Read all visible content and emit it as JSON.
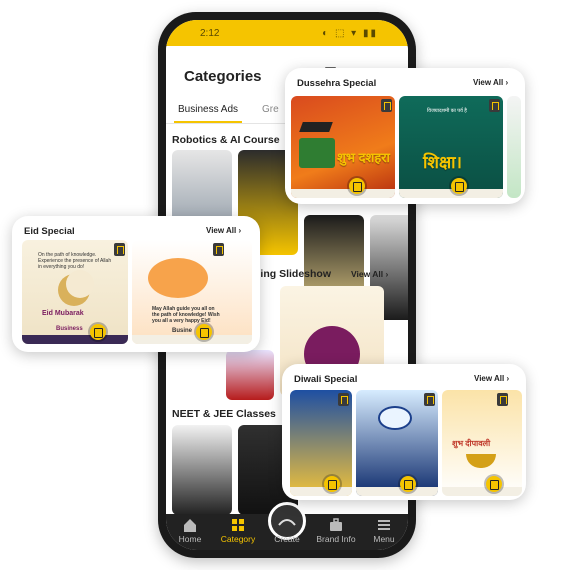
{
  "status": {
    "time": "2:12",
    "icons": "◐ ⬚ ▾ ▮▮"
  },
  "app": {
    "title": "Categories",
    "tabs": [
      {
        "label": "Business Ads"
      },
      {
        "label": "Gre"
      }
    ]
  },
  "sections": [
    {
      "title": "Robotics &  AI Course"
    },
    {
      "title": "hing Slideshow",
      "view_all": "View All"
    },
    {
      "title": "NEET & JEE Classes"
    }
  ],
  "bottom_nav": [
    {
      "label": "Home",
      "icon": "home-icon"
    },
    {
      "label": "Category",
      "icon": "category-icon"
    },
    {
      "label": "Create",
      "icon": "create-icon"
    },
    {
      "label": "Brand Info",
      "icon": "briefcase-icon"
    },
    {
      "label": "Menu",
      "icon": "menu-icon"
    }
  ],
  "dussehra": {
    "title": "Dussehra Special",
    "view_all": "View All",
    "card1_text": "शुभ दशहरा",
    "card2_text": "शिक्षा।",
    "card2_caption": "विजयादशमी का पर्व है"
  },
  "eid": {
    "title": "Eid Special",
    "view_all": "View All",
    "card1_text": "Eid Mubarak",
    "card1_small": "On the path of knowledge. Experience the presence of Allah in everything you do!",
    "card1_label": "Business",
    "card2_small": "May Allah guide you all on the path of knowledge! Wish you all a very happy Eid!",
    "card2_label": "Busine"
  },
  "diwali": {
    "title": "Diwali Special",
    "view_all": "View All",
    "card3_text": "शुभ दीपावली"
  },
  "colors": {
    "accent": "#f5c400",
    "nav": "#222222"
  }
}
